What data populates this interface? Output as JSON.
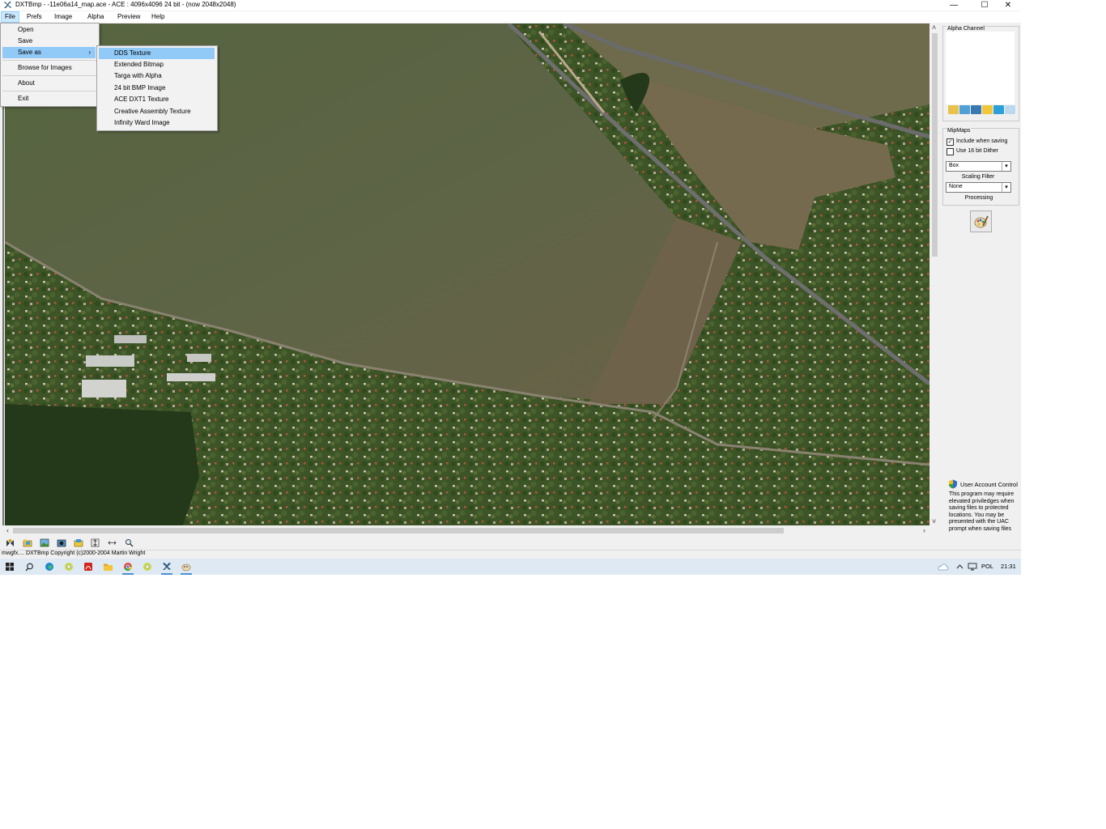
{
  "window": {
    "title": "DXTBmp - -11e06a14_map.ace - ACE : 4096x4096 24 bit - (now 2048x2048)",
    "caption_buttons": {
      "minimize": "—",
      "maximize": "☐",
      "close": "✕"
    }
  },
  "menubar": {
    "items": [
      "File",
      "Prefs",
      "Image",
      "Alpha",
      "Preview",
      "Help"
    ]
  },
  "file_menu": {
    "items": [
      "Open",
      "Save",
      "Save as",
      "Browse for Images",
      "About",
      "Exit"
    ],
    "submenu_arrow": "›"
  },
  "save_as_menu": {
    "items": [
      "DDS Texture",
      "Extended Bitmap",
      "Targa with Alpha",
      "24 bit BMP Image",
      "ACE DXT1 Texture",
      "Creative Assembly Texture",
      "Infinity Ward Image"
    ],
    "highlighted": "DDS Texture"
  },
  "alpha_panel": {
    "label": "Alpha Channel",
    "icons": [
      "open-icon",
      "import-icon",
      "camera-icon",
      "export-icon",
      "monitor-icon",
      "zoom-icon"
    ]
  },
  "mipmaps_panel": {
    "label": "MipMaps",
    "include_when_saving": {
      "label": "Include when saving",
      "checked": true,
      "mark": "✓"
    },
    "use_16bit_dither": {
      "label": "Use 16 bit Dither",
      "checked": false,
      "mark": ""
    },
    "scaling_filter": {
      "value": "Box",
      "label": "Scaling Filter"
    },
    "processing": {
      "value": "None",
      "label": "Processing"
    },
    "arrow": "▾"
  },
  "uac": {
    "title": "User Account Control",
    "text": "This program may require elevated priviledges when saving files to protected locations. You may be presented with the UAC prompt when saving files"
  },
  "status": {
    "text": "mwgfx.... DXTBmp Copyright (c)2000-2004 Martin Wright"
  },
  "scroll": {
    "up": "˄",
    "down": "˅",
    "left": "‹",
    "right": "›"
  },
  "taskbar": {
    "language": "POL",
    "time": "21:31"
  }
}
